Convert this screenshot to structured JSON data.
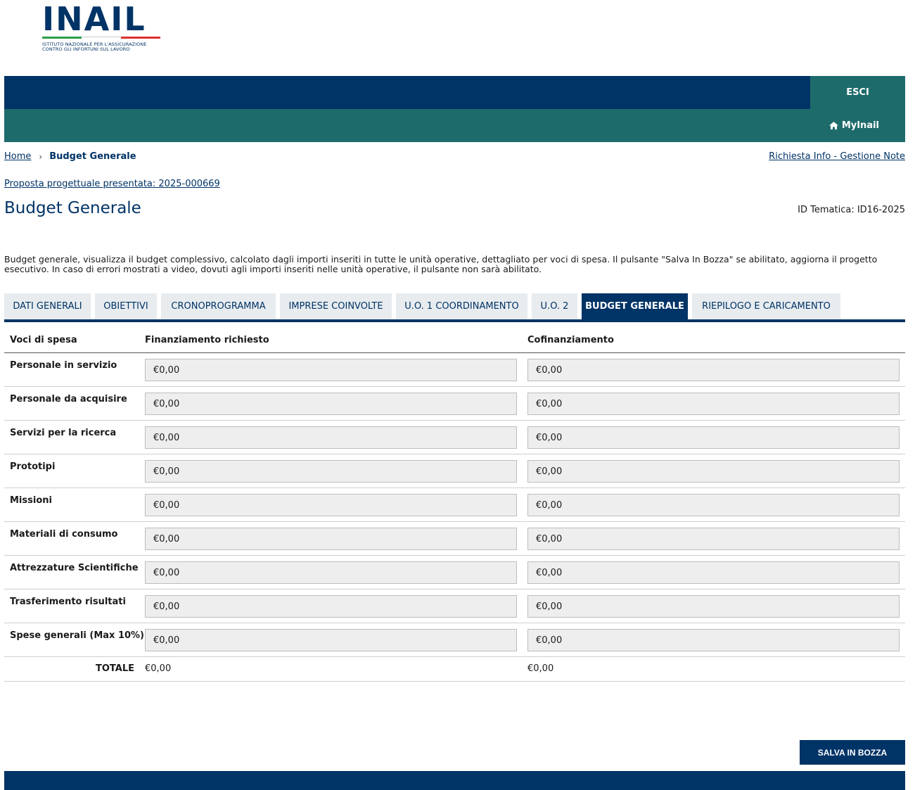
{
  "logo": {
    "wordmark": "INAIL",
    "subtitle": "ISTITUTO NAZIONALE PER L'ASSICURAZIONE\nCONTRO GLI INFORTUNI SUL LAVORO"
  },
  "colors": {
    "navy": "#003366",
    "teal": "#1e6b6b",
    "tab_bg": "#e8ecef",
    "field_bg": "#eeeeee"
  },
  "header": {
    "logout_label": "ESCI",
    "mylnail_label": "MyInail",
    "mylnail_icon": "home-icon"
  },
  "breadcrumb": {
    "home": "Home",
    "current": "Budget Generale"
  },
  "info_link": "Richiesta Info - Gestione Note",
  "proposta_link": "Proposta progettuale presentata: 2025-000669",
  "page": {
    "title": "Budget Generale",
    "id_tematica": "ID Tematica: ID16-2025",
    "description": "Budget generale, visualizza il budget complessivo, calcolato dagli importi inseriti in tutte le unità operative, dettagliato per voci di spesa. Il pulsante \"Salva In Bozza\" se abilitato, aggiorna il progetto esecutivo. In caso di errori mostrati a video, dovuti agli importi inseriti nelle unità operative, il pulsante non sarà abilitato."
  },
  "tabs": [
    {
      "label": "DATI GENERALI"
    },
    {
      "label": "OBIETTIVI"
    },
    {
      "label": "CRONOPROGRAMMA"
    },
    {
      "label": "IMPRESE COINVOLTE"
    },
    {
      "label": "U.O. 1 COORDINAMENTO"
    },
    {
      "label": "U.O. 2"
    },
    {
      "label": "BUDGET GENERALE"
    },
    {
      "label": "RIEPILOGO E CARICAMENTO"
    }
  ],
  "active_tab": "BUDGET GENERALE",
  "table": {
    "headers": [
      "Voci di spesa",
      "Finanziamento richiesto",
      "Cofinanziamento"
    ],
    "rows": [
      {
        "label": "Personale in servizio",
        "finanziamento": "€0,00",
        "cofinanziamento": "€0,00"
      },
      {
        "label": "Personale da acquisire",
        "finanziamento": "€0,00",
        "cofinanziamento": "€0,00"
      },
      {
        "label": "Servizi per la ricerca",
        "finanziamento": "€0,00",
        "cofinanziamento": "€0,00"
      },
      {
        "label": "Prototipi",
        "finanziamento": "€0,00",
        "cofinanziamento": "€0,00"
      },
      {
        "label": "Missioni",
        "finanziamento": "€0,00",
        "cofinanziamento": "€0,00"
      },
      {
        "label": "Materiali di consumo",
        "finanziamento": "€0,00",
        "cofinanziamento": "€0,00"
      },
      {
        "label": "Attrezzature Scientifiche",
        "finanziamento": "€0,00",
        "cofinanziamento": "€0,00"
      },
      {
        "label": "Trasferimento risultati",
        "finanziamento": "€0,00",
        "cofinanziamento": "€0,00"
      },
      {
        "label": "Spese generali (Max 10%)",
        "finanziamento": "€0,00",
        "cofinanziamento": "€0,00"
      }
    ],
    "total": {
      "label": "TOTALE",
      "finanziamento": "€0,00",
      "cofinanziamento": "€0,00"
    }
  },
  "save_button": "SALVA IN BOZZA"
}
